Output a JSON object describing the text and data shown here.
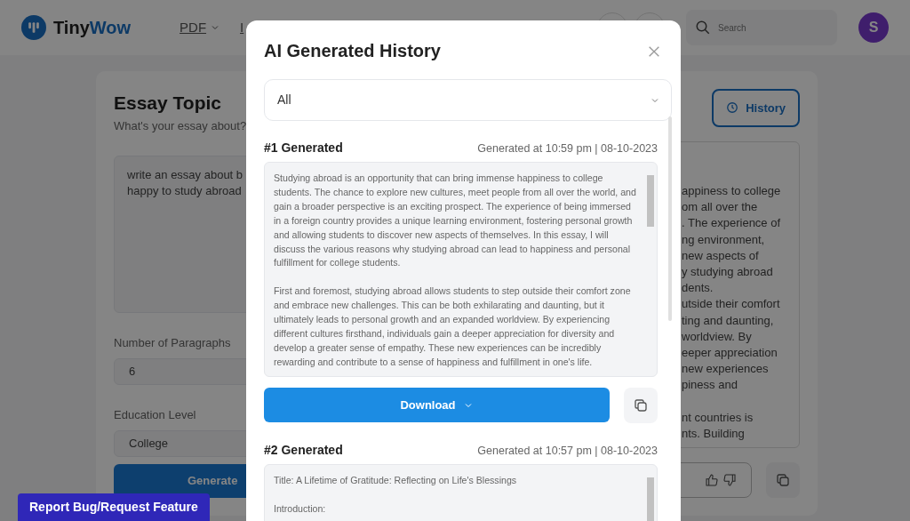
{
  "header": {
    "brand_first": "Tiny",
    "brand_second": "Wow",
    "nav": [
      {
        "label": "PDF",
        "dropdown": true
      },
      {
        "label": "I",
        "dropdown": false
      }
    ],
    "search": {
      "placeholder": "Search"
    },
    "avatar": "S"
  },
  "essay": {
    "title": "Essay Topic",
    "subtitle": "What's your essay about?",
    "topic_value": "write an essay about b\nhappy to study abroad",
    "paragraphs_label": "Number of Paragraphs",
    "paragraphs_value": "6",
    "level_label": "Education Level",
    "level_value": "College",
    "generate_label": "Generate"
  },
  "output": {
    "history_label": "History",
    "paragraphs": [
      [
        "appiness to college",
        "om all over the",
        ". The experience of",
        "ng environment,",
        "new aspects of",
        "y studying abroad",
        "dents.",
        "utside their comfort",
        "ting and daunting,",
        "worldview. By",
        "eeper appreciation",
        "new experiences",
        "piness and"
      ],
      [
        "nt countries is",
        "nts. Building"
      ]
    ]
  },
  "report_button": "Report Bug/Request Feature",
  "modal": {
    "title": "AI Generated History",
    "filter": "All",
    "entries": [
      {
        "heading": "#1 Generated",
        "timestamp": "Generated at 10:59 pm | 08-10-2023",
        "download_label": "Download",
        "paragraphs": [
          "Studying abroad is an opportunity that can bring immense happiness to college students. The chance to explore new cultures, meet people from all over the world, and gain a broader perspective is an exciting prospect. The experience of being immersed in a foreign country provides a unique learning environment, fostering personal growth and allowing students to discover new aspects of themselves. In this essay, I will discuss the various reasons why studying abroad can lead to happiness and personal fulfillment for college students.",
          "First and foremost, studying abroad allows students to step outside their comfort zone and embrace new challenges. This can be both exhilarating and daunting, but it ultimately leads to personal growth and an expanded worldview. By experiencing different cultures firsthand, individuals gain a deeper appreciation for diversity and develop a greater sense of empathy. These new experiences can be incredibly rewarding and contribute to a sense of happiness and fulfillment in one's life."
        ]
      },
      {
        "heading": "#2 Generated",
        "timestamp": "Generated at 10:57 pm | 08-10-2023",
        "paragraphs": [
          "Title: A Lifetime of Gratitude: Reflecting on Life's Blessings",
          "Introduction:"
        ]
      }
    ]
  }
}
